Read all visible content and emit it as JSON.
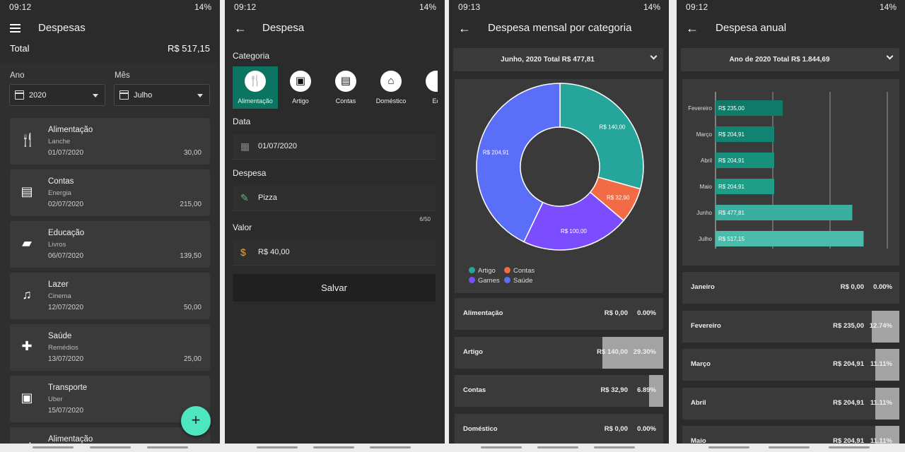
{
  "p1": {
    "status": {
      "time": "09:12",
      "battery": "14%"
    },
    "title": "Despesas",
    "total_label": "Total",
    "total_value": "R$  517,15",
    "year_label": "Ano",
    "month_label": "Mês",
    "year_value": "2020",
    "month_value": "Julho",
    "items": [
      {
        "title": "Alimentação",
        "sub": "Lanche",
        "date": "01/07/2020",
        "amount": "30,00",
        "icon": "fork-knife-icon"
      },
      {
        "title": "Contas",
        "sub": "Energia",
        "date": "02/07/2020",
        "amount": "215,00",
        "icon": "document-icon"
      },
      {
        "title": "Educação",
        "sub": "Livros",
        "date": "06/07/2020",
        "amount": "139,50",
        "icon": "book-reader-icon"
      },
      {
        "title": "Lazer",
        "sub": "Cinema",
        "date": "12/07/2020",
        "amount": "50,00",
        "icon": "leisure-icon"
      },
      {
        "title": "Saúde",
        "sub": "Remédios",
        "date": "13/07/2020",
        "amount": "25,00",
        "icon": "medical-bag-icon"
      },
      {
        "title": "Transporte",
        "sub": "Uber",
        "date": "15/07/2020",
        "amount": "",
        "icon": "bus-icon"
      },
      {
        "title": "Alimentação",
        "sub": "",
        "date": "",
        "amount": "",
        "icon": "fork-knife-icon"
      }
    ],
    "fab": "+"
  },
  "p2": {
    "status": {
      "time": "09:12",
      "battery": "14%"
    },
    "title": "Despesa",
    "category_label": "Categoria",
    "categories": [
      {
        "label": "Alimentação",
        "glyph": "🍴",
        "selected": true
      },
      {
        "label": "Artigo",
        "glyph": "▣"
      },
      {
        "label": "Contas",
        "glyph": "▤"
      },
      {
        "label": "Doméstico",
        "glyph": "⌂"
      },
      {
        "label": "Ed",
        "glyph": ""
      }
    ],
    "date_label": "Data",
    "date_value": "01/07/2020",
    "expense_label": "Despesa",
    "expense_value": "Pizza",
    "counter": "6/50",
    "value_label": "Valor",
    "value_value": "R$ 40,00",
    "save": "Salvar"
  },
  "p3": {
    "status": {
      "time": "09:13",
      "battery": "14%"
    },
    "title": "Despesa mensal por categoria",
    "header": "Junho, 2020   Total R$  477,81",
    "chart_data": {
      "type": "pie",
      "donut": true,
      "categories": [
        "Artigo",
        "Contas",
        "Games",
        "Saúde"
      ],
      "values": [
        140.0,
        32.9,
        100.0,
        204.91
      ],
      "data_labels": [
        "R$  140,00",
        "R$  32,90",
        "R$  100,00",
        "R$  204,91"
      ],
      "colors": [
        "#26a69a",
        "#f26b44",
        "#7b4dff",
        "#5b6ef7"
      ],
      "legend_position": "bottom-left"
    },
    "rows": [
      {
        "name": "Alimentação",
        "value": "R$  0,00",
        "pct": "0.00%",
        "frac": 0
      },
      {
        "name": "Artigo",
        "value": "R$  140,00",
        "pct": "29.30%",
        "frac": 0.293
      },
      {
        "name": "Contas",
        "value": "R$  32,90",
        "pct": "6.89%",
        "frac": 0.0689
      },
      {
        "name": "Doméstico",
        "value": "R$  0,00",
        "pct": "0.00%",
        "frac": 0
      }
    ]
  },
  "p4": {
    "status": {
      "time": "09:12",
      "battery": "14%"
    },
    "title": "Despesa anual",
    "header": "Ano de 2020   Total R$  1.844,69",
    "chart_data": {
      "type": "bar",
      "orientation": "horizontal",
      "categories": [
        "Fevereiro",
        "Março",
        "Abril",
        "Maio",
        "Junho",
        "Julho"
      ],
      "values": [
        235.0,
        204.91,
        204.91,
        204.91,
        477.81,
        517.15
      ],
      "data_labels": [
        "R$  235,00",
        "R$  204,91",
        "R$  204,91",
        "R$  204,91",
        "R$  477,81",
        "R$  517,15"
      ],
      "colors": [
        "#0f7a68",
        "#128572",
        "#17917c",
        "#1e9d87",
        "#3aafa0",
        "#4bbcac"
      ],
      "xlim": [
        0,
        600
      ],
      "grid": true
    },
    "rows": [
      {
        "name": "Janeiro",
        "value": "R$  0,00",
        "pct": "0.00%",
        "frac": 0
      },
      {
        "name": "Fevereiro",
        "value": "R$  235,00",
        "pct": "12.74%",
        "frac": 0.1274
      },
      {
        "name": "Março",
        "value": "R$  204,91",
        "pct": "11.11%",
        "frac": 0.1111
      },
      {
        "name": "Abril",
        "value": "R$  204,91",
        "pct": "11.11%",
        "frac": 0.1111
      },
      {
        "name": "Maio",
        "value": "R$  204,91",
        "pct": "11.11%",
        "frac": 0.1111
      }
    ]
  }
}
